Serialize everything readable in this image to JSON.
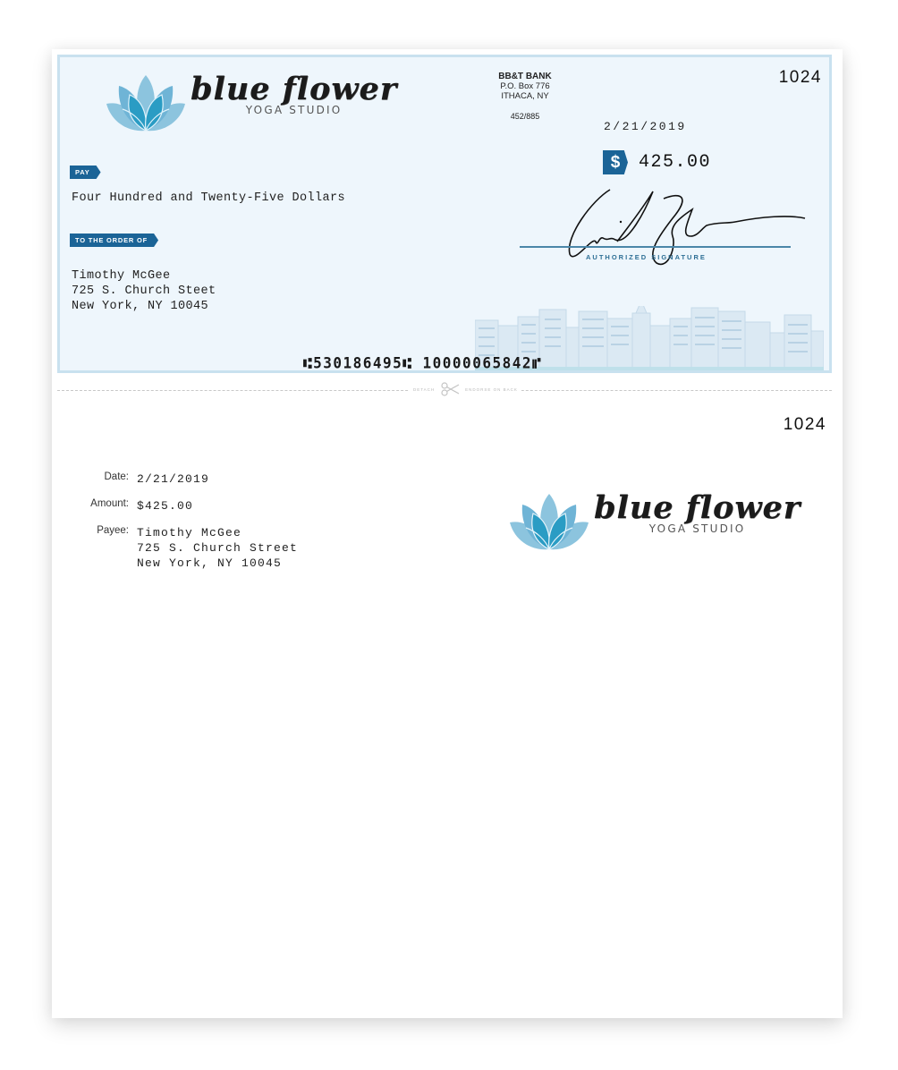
{
  "check": {
    "company": {
      "name": "blue flower",
      "tagline": "YOGA STUDIO"
    },
    "bank": {
      "name": "BB&T BANK",
      "address_line1": "P.O. Box 776",
      "address_line2": "ITHACA, NY",
      "fraction_code": "452/885"
    },
    "check_number": "1024",
    "date": "2/21/2019",
    "amount_symbol": "$",
    "amount": "425.00",
    "pay_label": "PAY",
    "written_amount": "Four Hundred and Twenty-Five Dollars",
    "order_label": "TO THE ORDER OF",
    "payee": {
      "name": "Timothy McGee",
      "address_line1": "725 S. Church Steet",
      "address_line2": "New York, NY 10045"
    },
    "signature_label": "AUTHORIZED SIGNATURE",
    "micr_line": "⑆530186495⑆  10000065842⑈"
  },
  "perforation": {
    "left_label": "DETACH",
    "right_label": "ENDORSE ON BACK"
  },
  "stub": {
    "check_number": "1024",
    "date_label": "Date:",
    "date": "2/21/2019",
    "amount_label": "Amount:",
    "amount": "$425.00",
    "payee_label": "Payee:",
    "payee_name": "Timothy McGee",
    "payee_address_line1": "725 S. Church Street",
    "payee_address_line2": "New York, NY 10045",
    "company": {
      "name": "blue flower",
      "tagline": "YOGA STUDIO"
    }
  },
  "colors": {
    "accent": "#1b6497",
    "check_background": "#eef6fc",
    "check_border": "#c9e1ef",
    "lotus_light": "#8cc4de",
    "lotus_dark": "#2a9cc4"
  }
}
